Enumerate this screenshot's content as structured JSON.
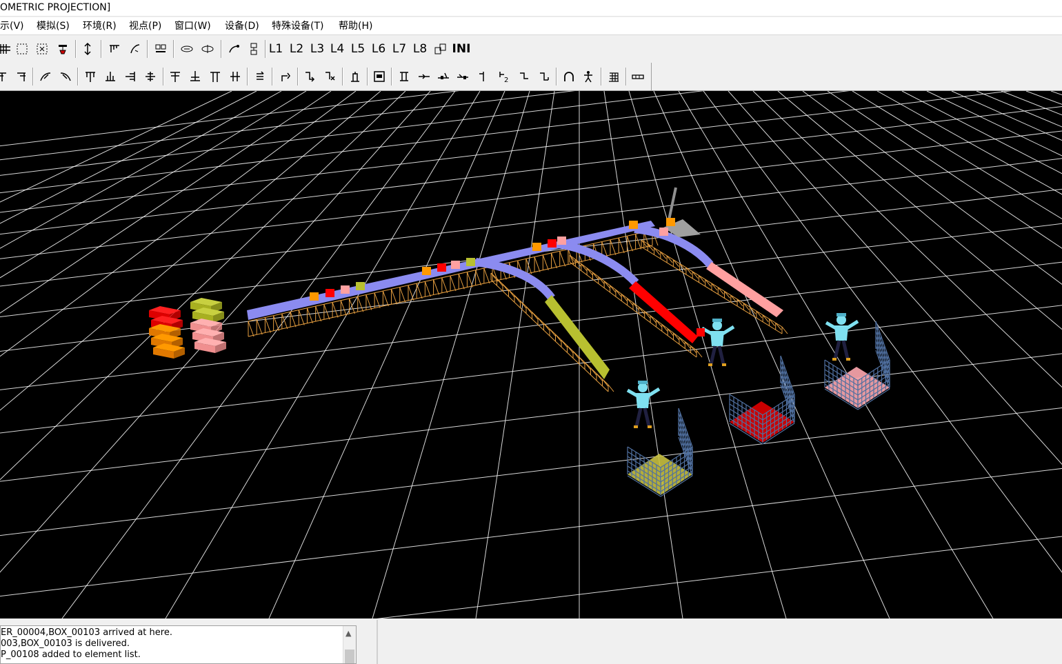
{
  "window": {
    "title": "OMETRIC PROJECTION]"
  },
  "menu": [
    {
      "label": "示(V)"
    },
    {
      "label": "模拟(S)"
    },
    {
      "label": "环境(R)"
    },
    {
      "label": "视点(P)"
    },
    {
      "label": "窗口(W)"
    },
    {
      "label": "设备(D)"
    },
    {
      "label": "特殊设备(T)"
    },
    {
      "label": "帮助(H)"
    }
  ],
  "toolbar1": {
    "layer_labels": [
      "L1",
      "L2",
      "L3",
      "L4",
      "L5",
      "L6",
      "L7",
      "L8"
    ],
    "ini_label": "INI",
    "icons": [
      "grid-icon",
      "select-rect-icon",
      "select-frame-icon",
      "robot-icon",
      "updown-arrow-icon",
      "conveyor-icon",
      "curve-icon",
      "group-icon",
      "rotate-icon",
      "rotate2-icon",
      "arc-icon",
      "link-icon",
      "copy-layer-icon"
    ]
  },
  "toolbar2": {
    "icons": [
      "align-left-icon",
      "align-right-icon",
      "merge-left-icon",
      "merge-right-icon",
      "split-icon",
      "split2-icon",
      "split3-icon",
      "split4-icon",
      "t-join-icon",
      "t-join2-icon",
      "t-join3-icon",
      "t-join4-icon",
      "stack-icon",
      "turn-icon",
      "turn2-icon",
      "turn3-icon",
      "push-icon",
      "panel-icon",
      "lift-icon",
      "gate-icon",
      "gate2-icon",
      "gate3-icon",
      "stop-icon",
      "stop2-icon",
      "stop3-icon",
      "stop4-icon",
      "arch-icon",
      "person-icon",
      "building-icon",
      "bar-icon"
    ]
  },
  "scene": {
    "background": "#000000",
    "grid_color": "#ffffff",
    "conveyor_color": "#8b8bf0",
    "frame_color": "#e8a040",
    "operator_color": "#7fe0f0",
    "box_colors": {
      "red": "#ff0000",
      "orange": "#ff9900",
      "pink": "#ffa0a0",
      "olive": "#b8c030"
    }
  },
  "log": {
    "lines": [
      "ER_00004,BOX_00103 arrived at here.",
      "003,BOX_00103 is delivered.",
      "P_00108 added to element list."
    ]
  }
}
